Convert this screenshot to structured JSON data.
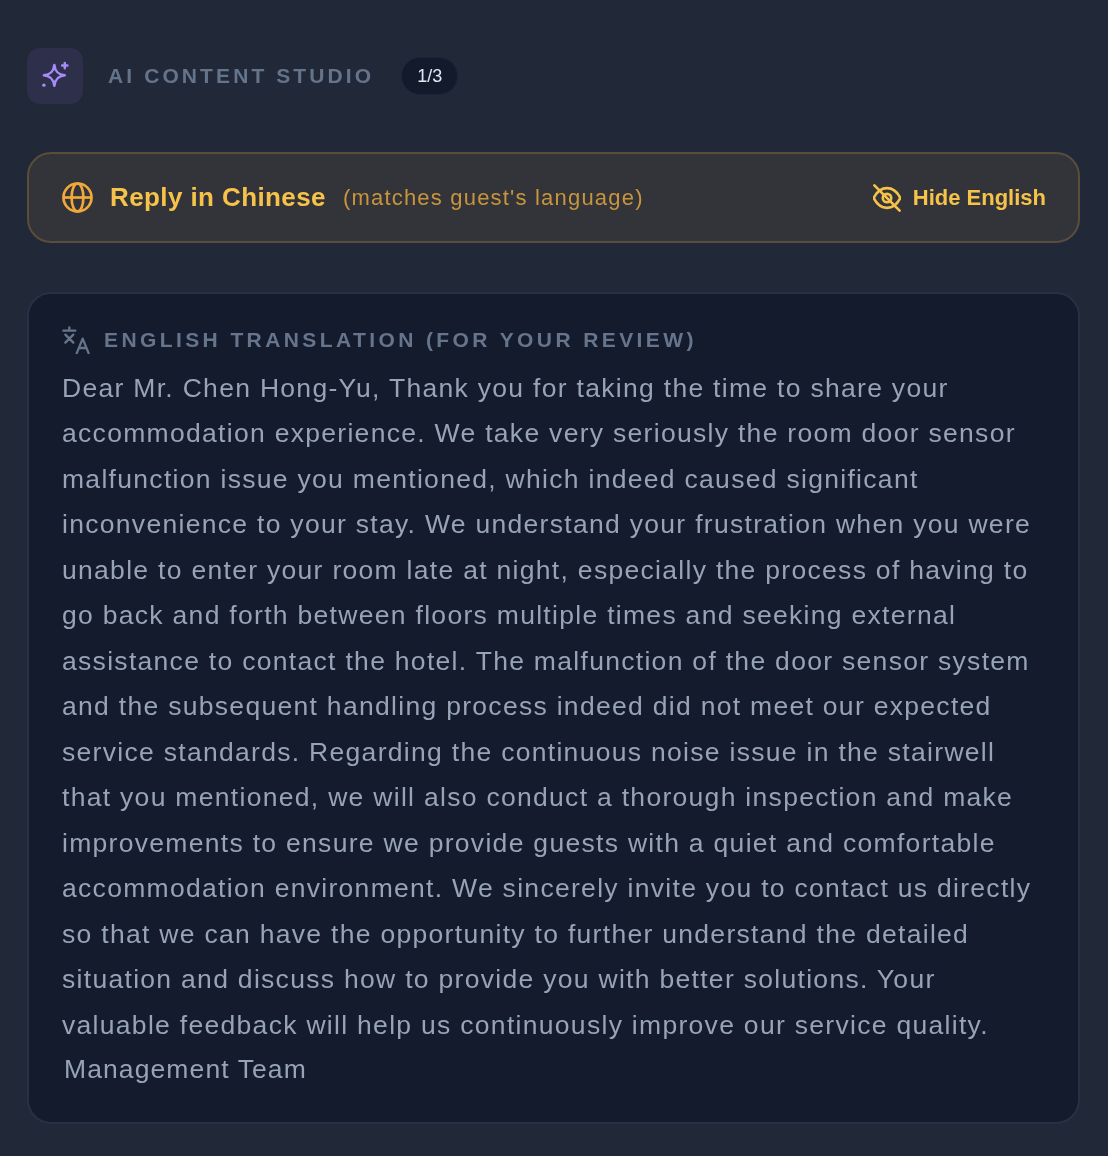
{
  "header": {
    "title": "AI CONTENT STUDIO",
    "counter": "1/3"
  },
  "language_banner": {
    "label": "Reply in Chinese",
    "note": "(matches guest's language)",
    "toggle": {
      "label": "Hide English"
    }
  },
  "translation": {
    "heading": "ENGLISH TRANSLATION (FOR YOUR REVIEW)",
    "paragraphs": [
      {
        "kind": "body",
        "text": "Dear Mr. Chen Hong-Yu, Thank you for taking the time to share your accommodation experience. We take very seriously the room door sensor malfunction issue you mentioned, which indeed caused significant inconvenience to your stay. We understand your frustration when you were unable to enter your room late at night, especially the process of having to go back and forth between floors multiple times and seeking external assistance to contact the hotel. The malfunction of the door sensor system and the subsequent handling process indeed did not meet our expected service standards. Regarding the continuous noise issue in the stairwell that you mentioned, we will also conduct a thorough inspection and make improvements to ensure we provide guests with a quiet and comfortable accommodation environment. We sincerely invite you to contact us directly so that we can have the opportunity to further understand the detailed situation and discuss how to provide you with better solutions. Your valuable feedback will help us continuously improve our service quality."
      },
      {
        "kind": "signature",
        "text": "Management Team"
      }
    ]
  }
}
